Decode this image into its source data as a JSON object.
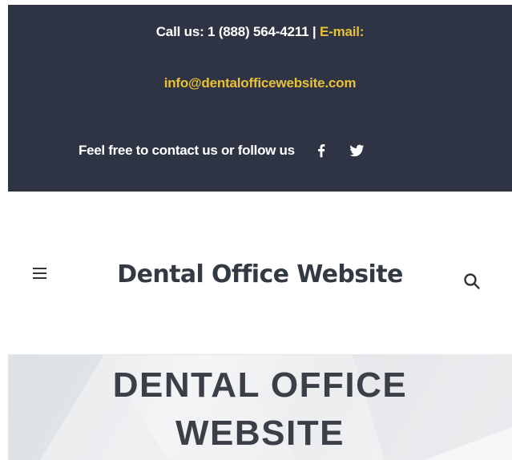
{
  "topbar": {
    "call_text": "Call us: 1 (888) 564-4211",
    "separator": "|",
    "email_label": "E-mail:",
    "email_address": "info@dentalofficewebsite.com",
    "follow_text": "Feel free to contact us or follow us",
    "social_icons": [
      "facebook-icon",
      "twitter-icon"
    ],
    "colors": {
      "background": "#2e3443",
      "accent": "#e8c13a",
      "text": "#ffffff"
    }
  },
  "header": {
    "site_title": "Dental Office Website",
    "menu_icon": "hamburger-menu-icon",
    "search_icon": "search-icon"
  },
  "hero": {
    "title_line1": "DENTAL OFFICE",
    "title_line2": "WEBSITE"
  }
}
